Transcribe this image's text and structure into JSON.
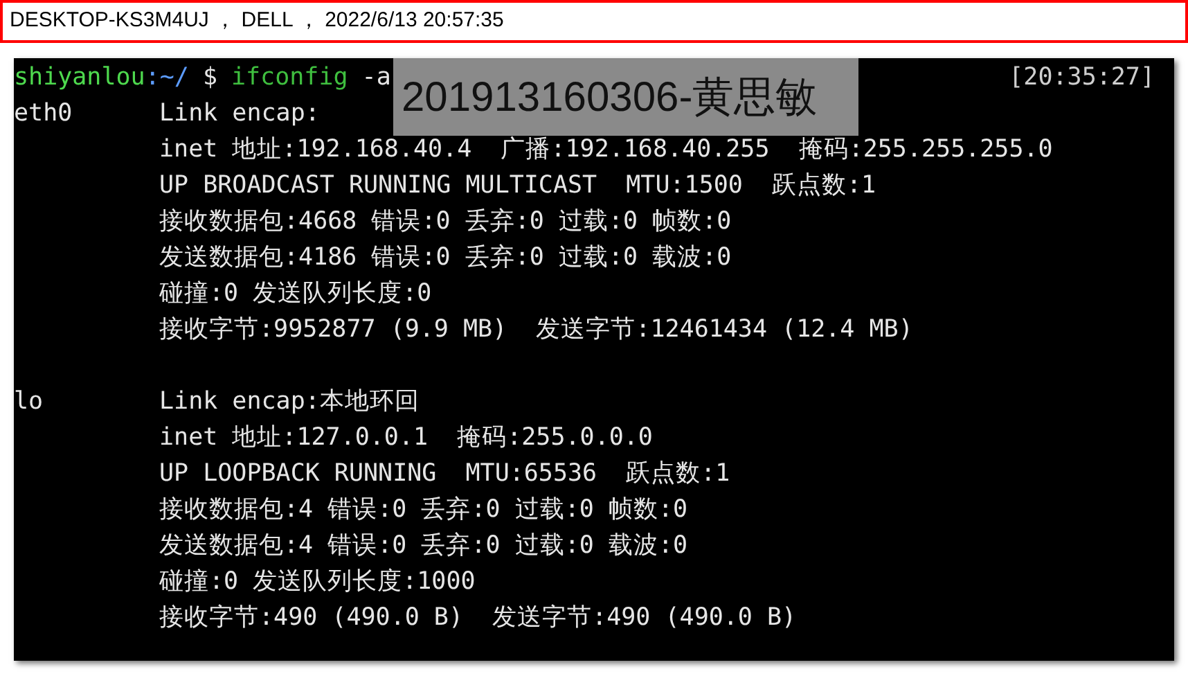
{
  "header": {
    "text": "DESKTOP-KS3M4UJ ， DELL ， 2022/6/13 20:57:35"
  },
  "terminal": {
    "prompt": {
      "user": "shiyanlou",
      "path": ":~/",
      "symbol": "$",
      "command": "ifconfig",
      "args": "-a"
    },
    "clock": "[20:35:27]",
    "interfaces": [
      {
        "name": "eth0",
        "lines": [
          "Link encap:",
          "inet 地址:192.168.40.4  广播:192.168.40.255  掩码:255.255.255.0",
          "UP BROADCAST RUNNING MULTICAST  MTU:1500  跃点数:1",
          "接收数据包:4668 错误:0 丢弃:0 过载:0 帧数:0",
          "发送数据包:4186 错误:0 丢弃:0 过载:0 载波:0",
          "碰撞:0 发送队列长度:0",
          "接收字节:9952877 (9.9 MB)  发送字节:12461434 (12.4 MB)"
        ]
      },
      {
        "name": "lo",
        "lines": [
          "Link encap:本地环回",
          "inet 地址:127.0.0.1  掩码:255.0.0.0",
          "UP LOOPBACK RUNNING  MTU:65536  跃点数:1",
          "接收数据包:4 错误:0 丢弃:0 过载:0 帧数:0",
          "发送数据包:4 错误:0 丢弃:0 过载:0 载波:0",
          "碰撞:0 发送队列长度:1000",
          "接收字节:490 (490.0 B)  发送字节:490 (490.0 B)"
        ]
      }
    ]
  },
  "watermark_label": {
    "text": "201913160306-黄思敏"
  }
}
